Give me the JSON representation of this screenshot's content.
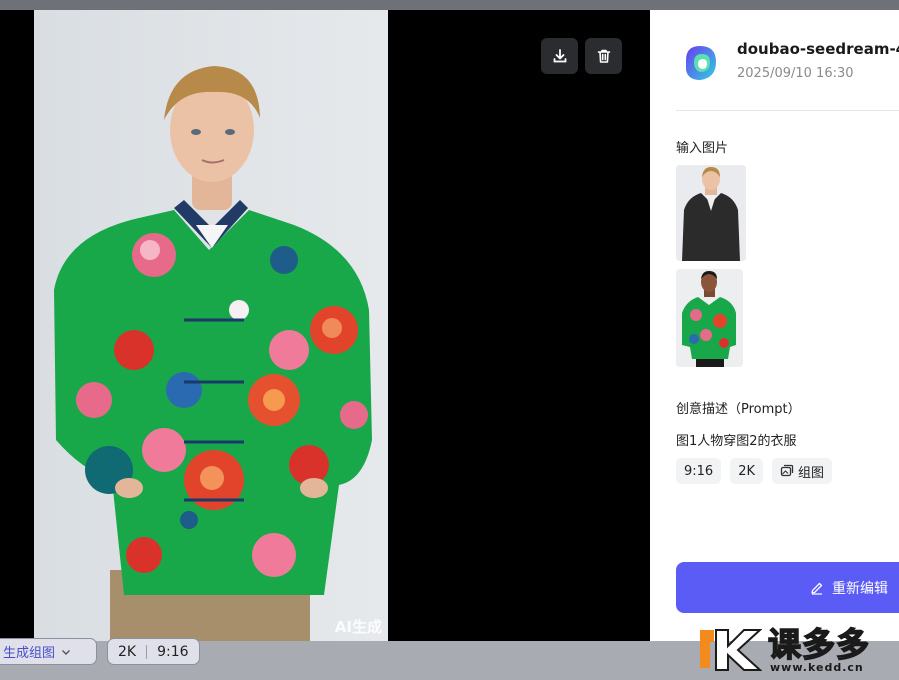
{
  "viewer": {
    "ai_badge": "AI生成",
    "download_icon": "download-icon",
    "delete_icon": "trash-icon"
  },
  "panel": {
    "model_name": "doubao-seedream-4-",
    "timestamp": "2025/09/10 16:30",
    "input_images_label": "输入图片",
    "prompt_label": "创意描述（Prompt）",
    "prompt_text": "图1人物穿图2的衣服",
    "tags": [
      "9:16",
      "2K",
      "组图"
    ],
    "regen_label": "重新编辑"
  },
  "bottom": {
    "generate_label": "生成组图",
    "resolution": "2K",
    "ratio": "9:16"
  },
  "watermark": {
    "name": "课多多",
    "url": "www.kedd.cn"
  },
  "colors": {
    "accent": "#5b5cf5",
    "jacket_green": "#18a84a"
  }
}
